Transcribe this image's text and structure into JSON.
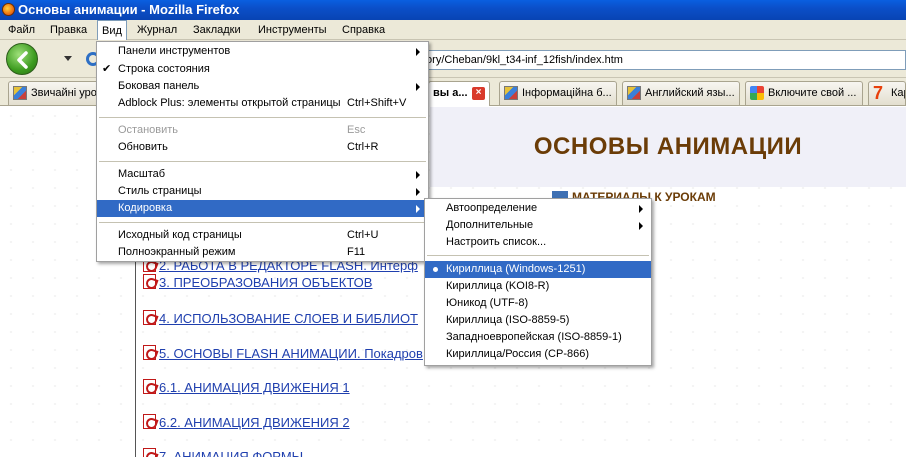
{
  "window": {
    "title": "Основы анимации - Mozilla Firefox"
  },
  "menubar": [
    "Файл",
    "Правка",
    "Вид",
    "Журнал",
    "Закладки",
    "Инструменты",
    "Справка"
  ],
  "nav": {
    "url": "tory/Cheban/9kl_t34-inf_12fish/index.htm"
  },
  "tabs": [
    {
      "label": "Звичайні уро",
      "icon": "paint-icon"
    },
    {
      "label": "вы а...",
      "icon": "page-icon"
    },
    {
      "label": "Інформаційна б...",
      "icon": "paint-icon"
    },
    {
      "label": "Английский язы...",
      "icon": "paint-icon"
    },
    {
      "label": "Включите свой ...",
      "icon": "google-icon"
    },
    {
      "label": "Кар",
      "icon": "seven-icon"
    }
  ],
  "page": {
    "title": "ОСНОВЫ АНИМАЦИИ",
    "materials": "МАТЕРИАЛЫ К УРОКАМ",
    "lessons": [
      "2. РАБОТА В РЕДАКТОРЕ FLASH. Интерф",
      "3. ПРЕОБРАЗОВАНИЯ ОБЪЕКТОВ",
      "4. ИСПОЛЬЗОВАНИЕ СЛОЕВ И БИБЛИОТ",
      "5. ОСНОВЫ FLASH АНИМАЦИИ. Покадров",
      "6.1. АНИМАЦИЯ ДВИЖЕНИЯ 1",
      "6.2. АНИМАЦИЯ ДВИЖЕНИЯ 2",
      "7. АНИМАЦИЯ ФОРМЫ"
    ]
  },
  "view_menu": {
    "items": [
      {
        "label": "Панели инструментов",
        "submenu": true
      },
      {
        "label": "Строка состояния",
        "checked": true
      },
      {
        "label": "Боковая панель",
        "submenu": true
      },
      {
        "label": "Adblock Plus: элементы открытой страницы",
        "shortcut": "Ctrl+Shift+V"
      },
      {
        "label": "Остановить",
        "shortcut": "Esc",
        "disabled": true
      },
      {
        "label": "Обновить",
        "shortcut": "Ctrl+R"
      },
      {
        "label": "Масштаб",
        "submenu": true
      },
      {
        "label": "Стиль страницы",
        "submenu": true
      },
      {
        "label": "Кодировка",
        "submenu": true,
        "highlighted": true
      },
      {
        "label": "Исходный код страницы",
        "shortcut": "Ctrl+U"
      },
      {
        "label": "Полноэкранный режим",
        "shortcut": "F11"
      }
    ]
  },
  "encoding_menu": {
    "items": [
      {
        "label": "Автоопределение",
        "submenu": true
      },
      {
        "label": "Дополнительные",
        "submenu": true
      },
      {
        "label": "Настроить список..."
      },
      {
        "label": "Кириллица (Windows-1251)",
        "selected": true
      },
      {
        "label": "Кириллица (KOI8-R)"
      },
      {
        "label": "Юникод (UTF-8)"
      },
      {
        "label": "Кириллица (ISO-8859-5)"
      },
      {
        "label": "Западноевропейская (ISO-8859-1)"
      },
      {
        "label": "Кириллица/Россия (CP-866)"
      }
    ]
  },
  "colors": {
    "highlight": "#316ac5",
    "title_brown": "#6b3c07",
    "link_blue": "#1f3fae"
  }
}
